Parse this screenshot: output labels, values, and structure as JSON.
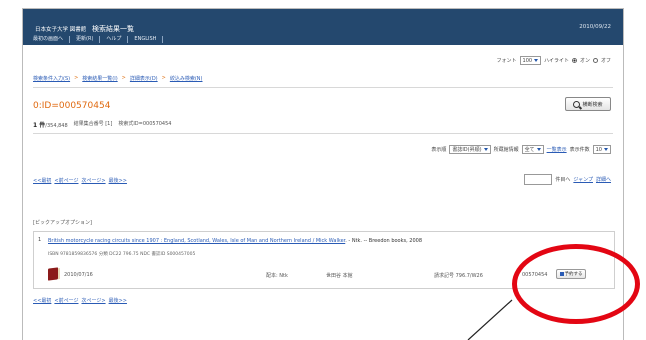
{
  "header": {
    "site_name": "日本女子大学 図書館",
    "page_title": "検索結果一覧",
    "date": "2010/09/22",
    "nav": [
      "最初の画面へ",
      "更新(R)",
      "ヘルプ",
      "ENGLISH"
    ]
  },
  "font_controls": {
    "font_label": "フォント",
    "font_size": "100",
    "highlight_label": "ハイライト",
    "on_label": "オン",
    "off_label": "オフ"
  },
  "breadcrumb": [
    "検索条件入力(S)",
    "検索結果一覧(I)",
    "詳細表示(D)",
    "絞込み検索(N)"
  ],
  "record_id": "0:ID=000570454",
  "advanced_search_label": "横断検索",
  "counts": {
    "hits": "1 件",
    "total": "/354,848",
    "history": "結果集合番号 [1]",
    "query": "検索式ID=000570454"
  },
  "display_options": {
    "format_label": "表示順",
    "format_value": "書誌ID(昇順)",
    "include_label": "所蔵館情報",
    "include_value": "全て",
    "display_label": "表示件数",
    "display_value": "10",
    "list_link": "一覧表示"
  },
  "pager": {
    "first": "<<最初",
    "prev": "<前ページ",
    "next": "次ページ>",
    "last": "最後>>"
  },
  "jump": {
    "suffix": "件目へ",
    "jump_link": "ジャンプ",
    "detail_link": "詳細へ"
  },
  "pickup_label": "[ピックアップオプション]",
  "result": {
    "number": "1",
    "title": "British motorcycle racing circuits since 1907 : England, Scotland, Wales, Isle of Man and Northern Ireland / Mick Walker",
    "title_suffix": ". - Ntk. -- Breedon books, 2008",
    "meta": "ISBN 9781859836576   分類 DC22 796.75 NDC   書誌ID S000457005",
    "year": "2010/07/16",
    "location": "配本: Ntk",
    "branch": "世田谷 本館",
    "call_number": "請求記号 796.7/W26",
    "id_no": "00570454",
    "lend_button": "予約する"
  },
  "colors": {
    "header_bg": "#24486e",
    "link": "#2a5bb5",
    "accent_orange": "#e06a10",
    "annotation_red": "#e30613"
  }
}
